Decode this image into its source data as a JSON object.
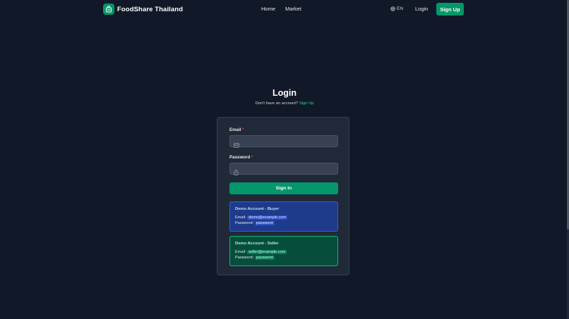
{
  "nav": {
    "brand": "FoodShare Thailand",
    "links": [
      "Home",
      "Market"
    ],
    "lang": "EN",
    "login": "Login",
    "signup": "Sign Up"
  },
  "page": {
    "title": "Login",
    "subtitle_prefix": "Don't have an account?",
    "subtitle_link": "Sign Up"
  },
  "form": {
    "email_label": "Email",
    "password_label": "Password",
    "required_mark": "*",
    "email_value": "",
    "password_value": "",
    "submit": "Sign In"
  },
  "demo_accounts": [
    {
      "title": "Demo Account - Buyer",
      "email_label": "Email:",
      "email": "demo@example.com",
      "password_label": "Password:",
      "password": "password"
    },
    {
      "title": "Demo Account - Seller",
      "email_label": "Email:",
      "email": "seller@example.com",
      "password_label": "Password:",
      "password": "password"
    }
  ],
  "icons": {
    "logo": "shopping-bag-icon",
    "lang": "globe-icon",
    "email": "mail-icon",
    "password": "lock-icon"
  },
  "colors": {
    "background": "#111827",
    "card": "#1f2937",
    "accent": "#059669",
    "buyer": "#1e3a8a",
    "seller": "#064e3b"
  }
}
